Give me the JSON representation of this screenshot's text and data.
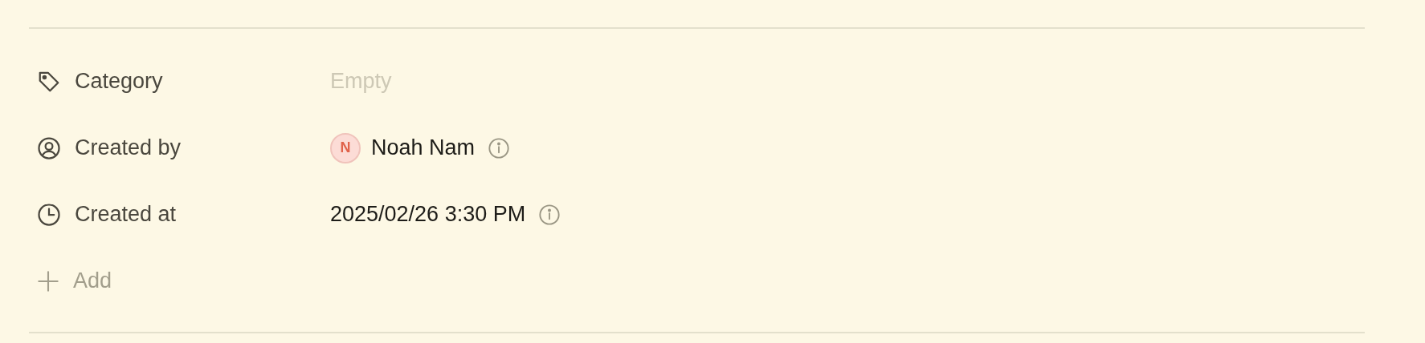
{
  "properties": [
    {
      "kind": "select",
      "label": "Category",
      "placeholder": "Empty"
    },
    {
      "kind": "person",
      "label": "Created by",
      "initial": "N",
      "value": "Noah Nam"
    },
    {
      "kind": "datetime",
      "label": "Created at",
      "value": "2025/02/26 3:30 PM"
    }
  ],
  "add_button": {
    "label": "Add"
  }
}
